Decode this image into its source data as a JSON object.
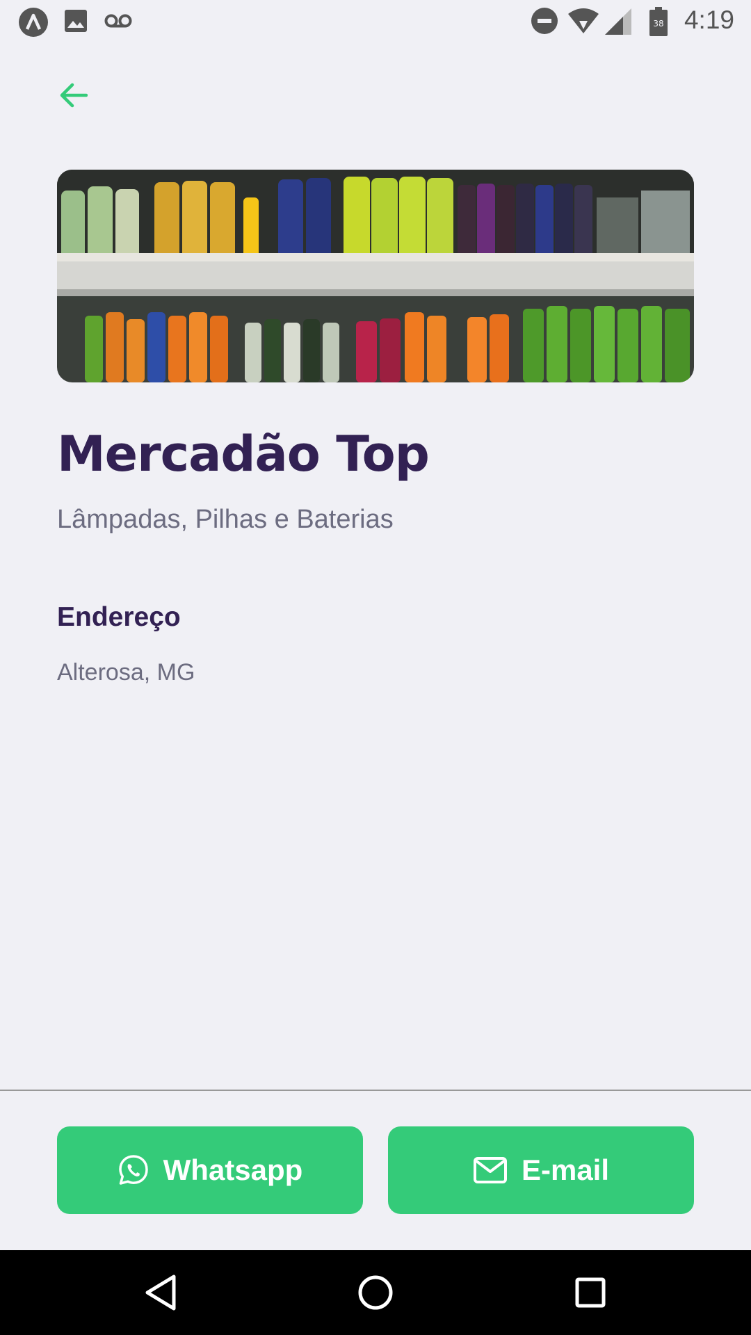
{
  "status_bar": {
    "time": "4:19",
    "battery_level": "38",
    "left_icons": [
      "app-notification-icon",
      "image-icon",
      "voicemail-icon"
    ],
    "right_icons": [
      "do-not-disturb-icon",
      "wifi-icon",
      "cell-signal-icon",
      "battery-icon"
    ]
  },
  "header": {
    "back_icon": "arrow-left-icon"
  },
  "store": {
    "name": "Mercadão Top",
    "categories": "Lâmpadas, Pilhas e Baterias",
    "image_description": "supermarket shelves with soda bottles"
  },
  "address": {
    "title": "Endereço",
    "text": "Alterosa, MG"
  },
  "footer": {
    "whatsapp_label": "Whatsapp",
    "email_label": "E-mail"
  },
  "nav": {
    "icons": [
      "back-icon",
      "home-icon",
      "recents-icon"
    ]
  },
  "colors": {
    "background": "#F0F0F5",
    "accent_green": "#34CB79",
    "title_purple": "#322153",
    "text_gray": "#6C6C80"
  }
}
